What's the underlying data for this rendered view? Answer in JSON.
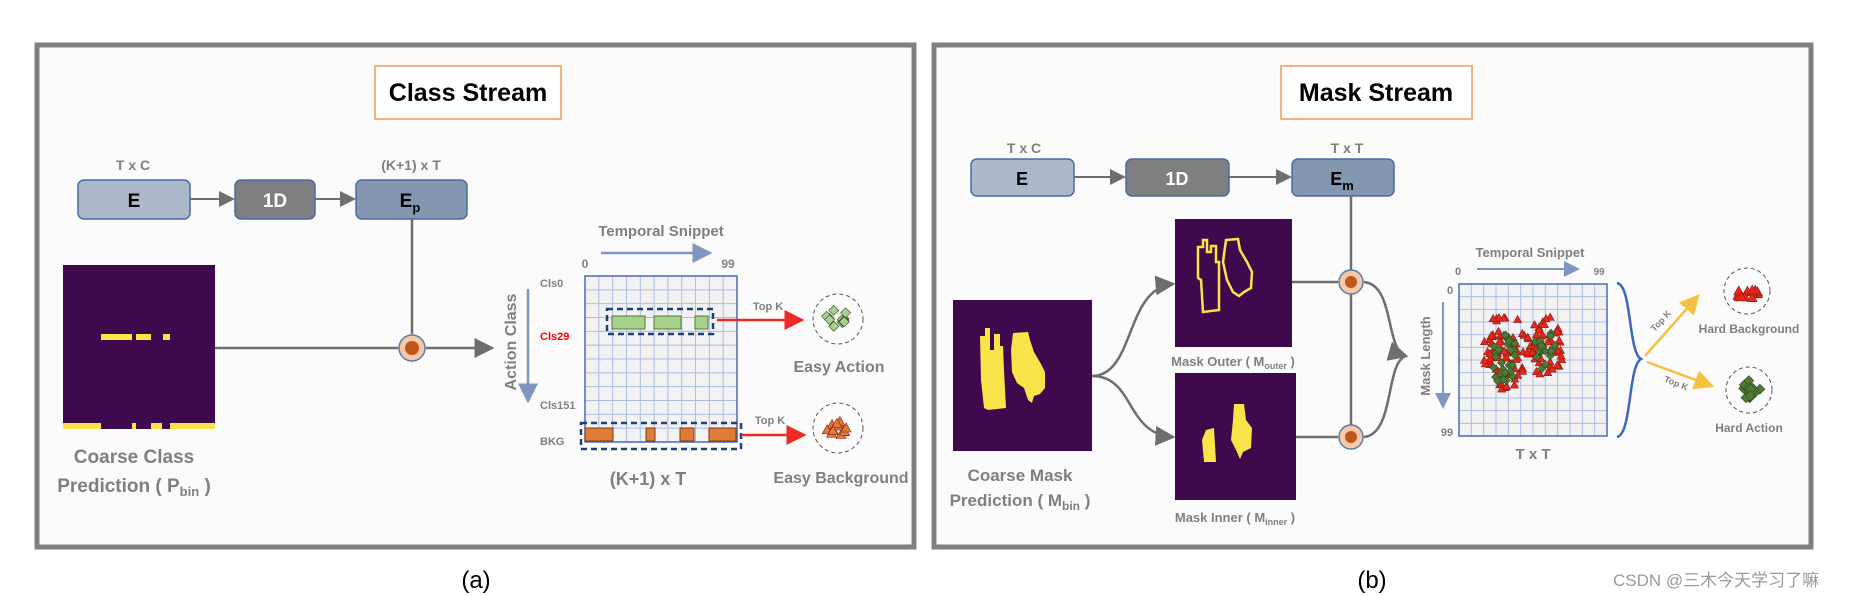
{
  "panel_a": {
    "title": "Class Stream",
    "caption": "(a)",
    "dims": {
      "e": "T x C",
      "ep": "(K+1) x T"
    },
    "boxes": {
      "e": "E",
      "conv": "1D",
      "ep_main": "E",
      "ep_sub": "p"
    },
    "prediction": {
      "line1": "Coarse Class",
      "line2_prefix": "Prediction ( P",
      "line2_sub": "bin",
      "line2_suffix": " )"
    },
    "grid": {
      "x_title": "Temporal Snippet",
      "x_start": "0",
      "x_end": "99",
      "y_title": "Action Class",
      "rows": [
        "Cls0",
        "Cls29",
        "Cls151",
        "BKG"
      ],
      "bottom_label": "(K+1) x T"
    },
    "outputs": [
      {
        "topk": "Top K",
        "label": "Easy Action"
      },
      {
        "topk": "Top K",
        "label": "Easy Background"
      }
    ]
  },
  "panel_b": {
    "title": "Mask Stream",
    "caption": "(b)",
    "dims": {
      "e": "T x C",
      "em": "T x T"
    },
    "boxes": {
      "e": "E",
      "conv": "1D",
      "em_main": "E",
      "em_sub": "m"
    },
    "prediction": {
      "line1": "Coarse Mask",
      "line2_prefix": "Prediction ( M",
      "line2_sub": "bin",
      "line2_suffix": " )"
    },
    "mask_outer": {
      "prefix": "Mask Outer ( M",
      "sub": "outer",
      "suffix": " )"
    },
    "mask_inner": {
      "prefix": "Mask Inner ( M",
      "sub": "inner",
      "suffix": " )"
    },
    "grid": {
      "x_title": "Temporal Snippet",
      "x_start": "0",
      "x_end": "99",
      "y_title": "Mask Length",
      "y_start": "0",
      "y_end": "99",
      "bottom_label": "T x T"
    },
    "outputs": [
      {
        "topk": "Top K",
        "label": "Hard Background"
      },
      {
        "topk": "Top K",
        "label": "Hard Action"
      }
    ]
  },
  "watermark": "CSDN @三木今天学习了嘛",
  "colors": {
    "panel_border": "#808080",
    "title_border": "#f4b183",
    "box_e": "#adb9ca",
    "box_conv": "#7f7f7f",
    "box_ep": "#8497b0",
    "map_bg": "#3e0a4d",
    "map_fg": "#f9e449",
    "action_green": "#a9d18e",
    "background_orange": "#e07b39",
    "hard_red": "#e8271c",
    "hard_green": "#4f7a35",
    "topk_red_arrow": "#ee2a24",
    "topk_yellow_arrow": "#f6c142",
    "highlight_class": "#ff0000"
  }
}
